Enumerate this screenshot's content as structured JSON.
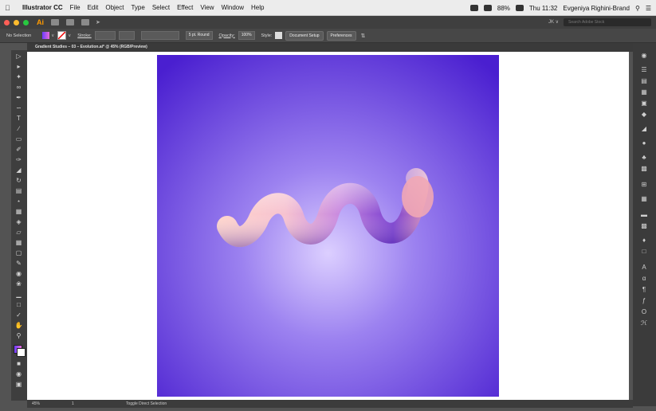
{
  "menubar": {
    "app_name": "Illustrator CC",
    "items": [
      "File",
      "Edit",
      "Object",
      "Type",
      "Select",
      "Effect",
      "View",
      "Window",
      "Help"
    ],
    "battery": "88%",
    "clock": "Thu 11:32",
    "user": "Evgeniya Righini-Brand"
  },
  "appbar": {
    "logo": "Ai",
    "account": "JK ∨",
    "search_placeholder": "Search Adobe Stock"
  },
  "control": {
    "selection": "No Selection",
    "stroke_label": "Stroke:",
    "brush": "5 pt. Round",
    "opacity_label": "Opacity:",
    "opacity_value": "100%",
    "style_label": "Style:",
    "doc_setup": "Document Setup",
    "preferences": "Preferences"
  },
  "document": {
    "tab_title": "Gradient Studies – 03 – Evolution.ai* @ 45% (RGB/Preview)"
  },
  "status": {
    "zoom": "45%",
    "page": "1",
    "tool_hint": "Toggle Direct Selection"
  },
  "colors": {
    "bg_center": "#d7c9ff",
    "bg_edge": "#4a1fd0",
    "worm_light": "#ffd7cf",
    "worm_mid": "#d48ee0",
    "worm_dark": "#4a1bb8"
  }
}
